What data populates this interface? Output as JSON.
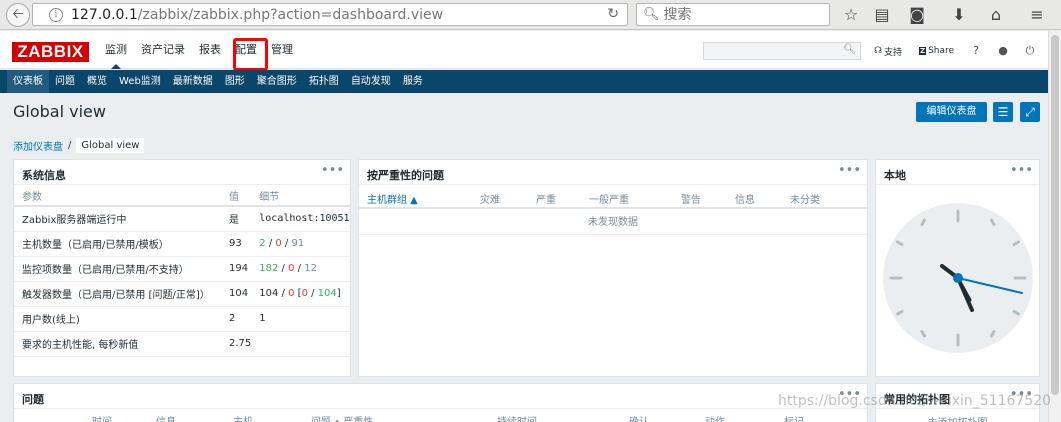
{
  "browser": {
    "url_host": "127.0.0.1",
    "url_path": "/zabbix/zabbix.php?action=dashboard.view",
    "search_placeholder": "搜索"
  },
  "header": {
    "logo": "ZABBIX",
    "menu": [
      "监测",
      "资产记录",
      "报表",
      "配置",
      "管理"
    ],
    "active_menu": "监测",
    "highlighted_menu": "配置",
    "support_label": "支持",
    "share_label": "Share",
    "help_label": "?"
  },
  "submenu": [
    "仪表板",
    "问题",
    "概览",
    "Web监测",
    "最新数据",
    "图形",
    "聚合图形",
    "拓扑图",
    "自动发现",
    "服务"
  ],
  "page": {
    "title": "Global view",
    "edit_button": "编辑仪表盘",
    "breadcrumb": [
      "添加仪表盘",
      "Global view"
    ]
  },
  "system_info": {
    "title": "系统信息",
    "columns": [
      "参数",
      "值",
      "细节"
    ],
    "rows": [
      {
        "param": "Zabbix服务器端运行中",
        "value": "是",
        "detail": "localhost:10051"
      },
      {
        "param": "主机数量（已启用/已禁用/模板）",
        "value": "93",
        "d1": "2",
        "d2": "0",
        "d3": "91"
      },
      {
        "param": "监控项数量（已启用/已禁用/不支持）",
        "value": "194",
        "d1": "182",
        "d2": "0",
        "d3": "12"
      },
      {
        "param": "触发器数量（已启用/已禁用 [问题/正常]）",
        "value": "104",
        "d1": "104",
        "d2": "0",
        "d3": "0",
        "d4": "104"
      },
      {
        "param": "用户数(线上)",
        "value": "2",
        "detail": "1"
      },
      {
        "param": "要求的主机性能, 每秒新值",
        "value": "2.75",
        "detail": ""
      }
    ]
  },
  "severity": {
    "title": "按严重性的问题",
    "columns": [
      "主机群组 ▲",
      "灾难",
      "严重",
      "一般严重",
      "警告",
      "信息",
      "未分类"
    ],
    "no_data": "未发现数据"
  },
  "local": {
    "title": "本地"
  },
  "problems": {
    "title": "问题",
    "columns": [
      "时间",
      "信息",
      "主机",
      "问题 • 严重性",
      "持续时间",
      "确认",
      "动作",
      "标记"
    ]
  },
  "maps": {
    "title": "常用的拓扑图",
    "empty": "未添加拓扑图"
  },
  "watermark": "https://blog.csdn.net/weixin_51167520"
}
